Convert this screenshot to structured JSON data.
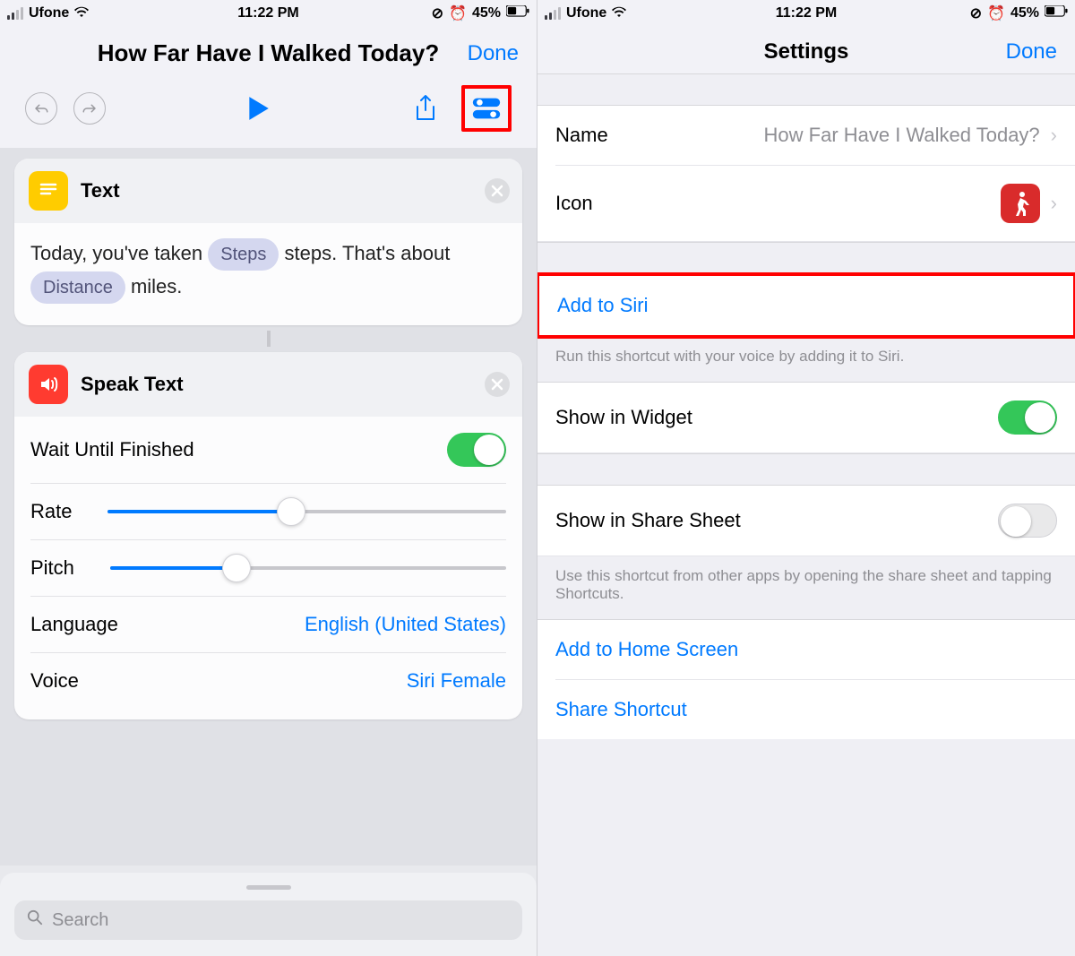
{
  "status": {
    "carrier": "Ufone",
    "time": "11:22 PM",
    "battery_pct": "45%"
  },
  "left": {
    "title": "How Far Have I Walked Today?",
    "done": "Done",
    "cards": {
      "text": {
        "title": "Text",
        "body_prefix": "Today, you've taken",
        "token1": "Steps",
        "body_mid": "steps. That's about",
        "token2": "Distance",
        "body_suffix": "miles."
      },
      "speak": {
        "title": "Speak Text",
        "wait_label": "Wait Until Finished",
        "rate_label": "Rate",
        "rate_pct": 46,
        "pitch_label": "Pitch",
        "pitch_pct": 32,
        "language_label": "Language",
        "language_value": "English (United States)",
        "voice_label": "Voice",
        "voice_value": "Siri Female"
      }
    },
    "search_placeholder": "Search"
  },
  "right": {
    "title": "Settings",
    "done": "Done",
    "name_label": "Name",
    "name_value": "How Far Have I Walked Today?",
    "icon_label": "Icon",
    "add_siri": "Add to Siri",
    "siri_footer": "Run this shortcut with your voice by adding it to Siri.",
    "widget_label": "Show in Widget",
    "sharesheet_label": "Show in Share Sheet",
    "sharesheet_footer": "Use this shortcut from other apps by opening the share sheet and tapping Shortcuts.",
    "add_home": "Add to Home Screen",
    "share_shortcut": "Share Shortcut"
  }
}
